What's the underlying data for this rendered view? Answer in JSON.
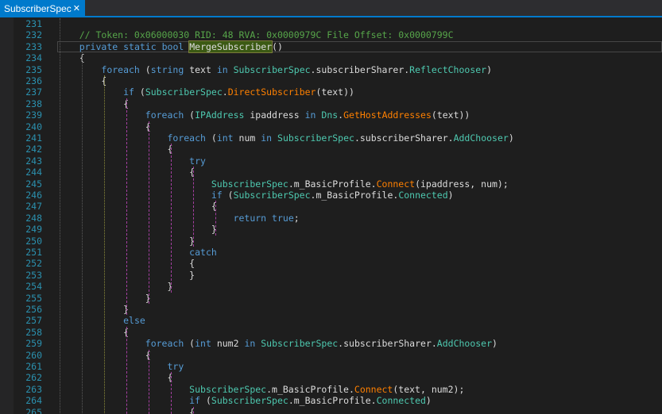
{
  "tab": {
    "title": "SubscriberSpec",
    "close": "✕"
  },
  "lines": [
    {
      "n": "231",
      "tokens": []
    },
    {
      "n": "232",
      "tokens": [
        {
          "t": "    // Token: 0x06000030 RID: 48 RVA: 0x0000979C File Offset: 0x0000799C",
          "c": "cmt"
        }
      ]
    },
    {
      "n": "233",
      "tokens": [
        {
          "t": "    "
        },
        {
          "t": "private",
          "c": "kw"
        },
        {
          "t": " "
        },
        {
          "t": "static",
          "c": "kw"
        },
        {
          "t": " "
        },
        {
          "t": "bool",
          "c": "kw"
        },
        {
          "t": " "
        },
        {
          "t": "MergeSubscriber",
          "c": "hl"
        },
        {
          "t": "()"
        }
      ]
    },
    {
      "n": "234",
      "tokens": [
        {
          "t": "    {"
        }
      ]
    },
    {
      "n": "235",
      "tokens": [
        {
          "t": "        "
        },
        {
          "t": "foreach",
          "c": "kw"
        },
        {
          "t": " ("
        },
        {
          "t": "string",
          "c": "kw"
        },
        {
          "t": " text "
        },
        {
          "t": "in",
          "c": "kw"
        },
        {
          "t": " "
        },
        {
          "t": "SubscriberSpec",
          "c": "cls"
        },
        {
          "t": ".subscriberSharer."
        },
        {
          "t": "ReflectChooser",
          "c": "prp"
        },
        {
          "t": ")"
        }
      ]
    },
    {
      "n": "236",
      "tokens": [
        {
          "t": "        {"
        }
      ]
    },
    {
      "n": "237",
      "tokens": [
        {
          "t": "            "
        },
        {
          "t": "if",
          "c": "kw"
        },
        {
          "t": " ("
        },
        {
          "t": "SubscriberSpec",
          "c": "cls"
        },
        {
          "t": "."
        },
        {
          "t": "DirectSubscriber",
          "c": "mth"
        },
        {
          "t": "(text))"
        }
      ]
    },
    {
      "n": "238",
      "tokens": [
        {
          "t": "            {"
        }
      ]
    },
    {
      "n": "239",
      "tokens": [
        {
          "t": "                "
        },
        {
          "t": "foreach",
          "c": "kw"
        },
        {
          "t": " ("
        },
        {
          "t": "IPAddress",
          "c": "cls"
        },
        {
          "t": " ipaddress "
        },
        {
          "t": "in",
          "c": "kw"
        },
        {
          "t": " "
        },
        {
          "t": "Dns",
          "c": "cls"
        },
        {
          "t": "."
        },
        {
          "t": "GetHostAddresses",
          "c": "mth"
        },
        {
          "t": "(text))"
        }
      ]
    },
    {
      "n": "240",
      "tokens": [
        {
          "t": "                {"
        }
      ]
    },
    {
      "n": "241",
      "tokens": [
        {
          "t": "                    "
        },
        {
          "t": "foreach",
          "c": "kw"
        },
        {
          "t": " ("
        },
        {
          "t": "int",
          "c": "kw"
        },
        {
          "t": " num "
        },
        {
          "t": "in",
          "c": "kw"
        },
        {
          "t": " "
        },
        {
          "t": "SubscriberSpec",
          "c": "cls"
        },
        {
          "t": ".subscriberSharer."
        },
        {
          "t": "AddChooser",
          "c": "prp"
        },
        {
          "t": ")"
        }
      ]
    },
    {
      "n": "242",
      "tokens": [
        {
          "t": "                    {"
        }
      ]
    },
    {
      "n": "243",
      "tokens": [
        {
          "t": "                        "
        },
        {
          "t": "try",
          "c": "kw"
        }
      ]
    },
    {
      "n": "244",
      "tokens": [
        {
          "t": "                        {"
        }
      ]
    },
    {
      "n": "245",
      "tokens": [
        {
          "t": "                            "
        },
        {
          "t": "SubscriberSpec",
          "c": "cls"
        },
        {
          "t": ".m_BasicProfile."
        },
        {
          "t": "Connect",
          "c": "mth"
        },
        {
          "t": "(ipaddress, num);"
        }
      ]
    },
    {
      "n": "246",
      "tokens": [
        {
          "t": "                            "
        },
        {
          "t": "if",
          "c": "kw"
        },
        {
          "t": " ("
        },
        {
          "t": "SubscriberSpec",
          "c": "cls"
        },
        {
          "t": ".m_BasicProfile."
        },
        {
          "t": "Connected",
          "c": "prp"
        },
        {
          "t": ")"
        }
      ]
    },
    {
      "n": "247",
      "tokens": [
        {
          "t": "                            {"
        }
      ]
    },
    {
      "n": "248",
      "tokens": [
        {
          "t": "                                "
        },
        {
          "t": "return",
          "c": "kw"
        },
        {
          "t": " "
        },
        {
          "t": "true",
          "c": "kw"
        },
        {
          "t": ";"
        }
      ]
    },
    {
      "n": "249",
      "tokens": [
        {
          "t": "                            }"
        }
      ]
    },
    {
      "n": "250",
      "tokens": [
        {
          "t": "                        }"
        }
      ]
    },
    {
      "n": "251",
      "tokens": [
        {
          "t": "                        "
        },
        {
          "t": "catch",
          "c": "kw"
        }
      ]
    },
    {
      "n": "252",
      "tokens": [
        {
          "t": "                        {"
        }
      ]
    },
    {
      "n": "253",
      "tokens": [
        {
          "t": "                        }"
        }
      ]
    },
    {
      "n": "254",
      "tokens": [
        {
          "t": "                    }"
        }
      ]
    },
    {
      "n": "255",
      "tokens": [
        {
          "t": "                }"
        }
      ]
    },
    {
      "n": "256",
      "tokens": [
        {
          "t": "            }"
        }
      ]
    },
    {
      "n": "257",
      "tokens": [
        {
          "t": "            "
        },
        {
          "t": "else",
          "c": "kw"
        }
      ]
    },
    {
      "n": "258",
      "tokens": [
        {
          "t": "            {"
        }
      ]
    },
    {
      "n": "259",
      "tokens": [
        {
          "t": "                "
        },
        {
          "t": "foreach",
          "c": "kw"
        },
        {
          "t": " ("
        },
        {
          "t": "int",
          "c": "kw"
        },
        {
          "t": " num2 "
        },
        {
          "t": "in",
          "c": "kw"
        },
        {
          "t": " "
        },
        {
          "t": "SubscriberSpec",
          "c": "cls"
        },
        {
          "t": ".subscriberSharer."
        },
        {
          "t": "AddChooser",
          "c": "prp"
        },
        {
          "t": ")"
        }
      ]
    },
    {
      "n": "260",
      "tokens": [
        {
          "t": "                {"
        }
      ]
    },
    {
      "n": "261",
      "tokens": [
        {
          "t": "                    "
        },
        {
          "t": "try",
          "c": "kw"
        }
      ]
    },
    {
      "n": "262",
      "tokens": [
        {
          "t": "                    {"
        }
      ]
    },
    {
      "n": "263",
      "tokens": [
        {
          "t": "                        "
        },
        {
          "t": "SubscriberSpec",
          "c": "cls"
        },
        {
          "t": ".m_BasicProfile."
        },
        {
          "t": "Connect",
          "c": "mth"
        },
        {
          "t": "(text, num2);"
        }
      ]
    },
    {
      "n": "264",
      "tokens": [
        {
          "t": "                        "
        },
        {
          "t": "if",
          "c": "kw"
        },
        {
          "t": " ("
        },
        {
          "t": "SubscriberSpec",
          "c": "cls"
        },
        {
          "t": ".m_BasicProfile."
        },
        {
          "t": "Connected",
          "c": "prp"
        },
        {
          "t": ")"
        }
      ]
    },
    {
      "n": "265",
      "tokens": [
        {
          "t": "                        {"
        }
      ]
    }
  ]
}
